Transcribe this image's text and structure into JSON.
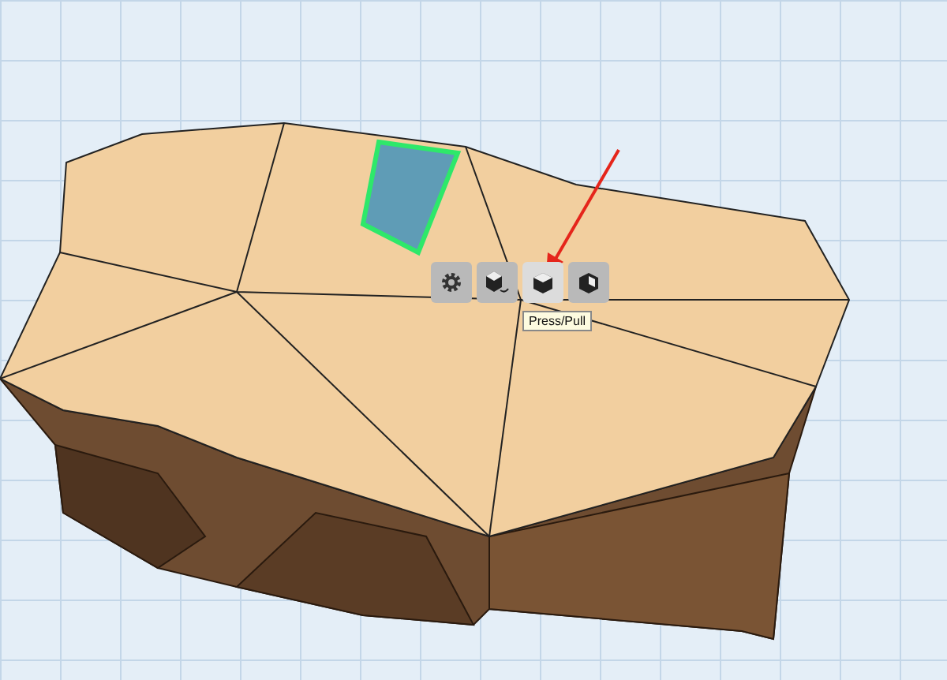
{
  "toolbar": {
    "buttons": [
      {
        "kind": "gear",
        "hovered": false
      },
      {
        "kind": "move",
        "hovered": false
      },
      {
        "kind": "presspull",
        "hovered": true
      },
      {
        "kind": "cube",
        "hovered": false
      }
    ]
  },
  "tooltip": {
    "text": "Press/Pull"
  }
}
